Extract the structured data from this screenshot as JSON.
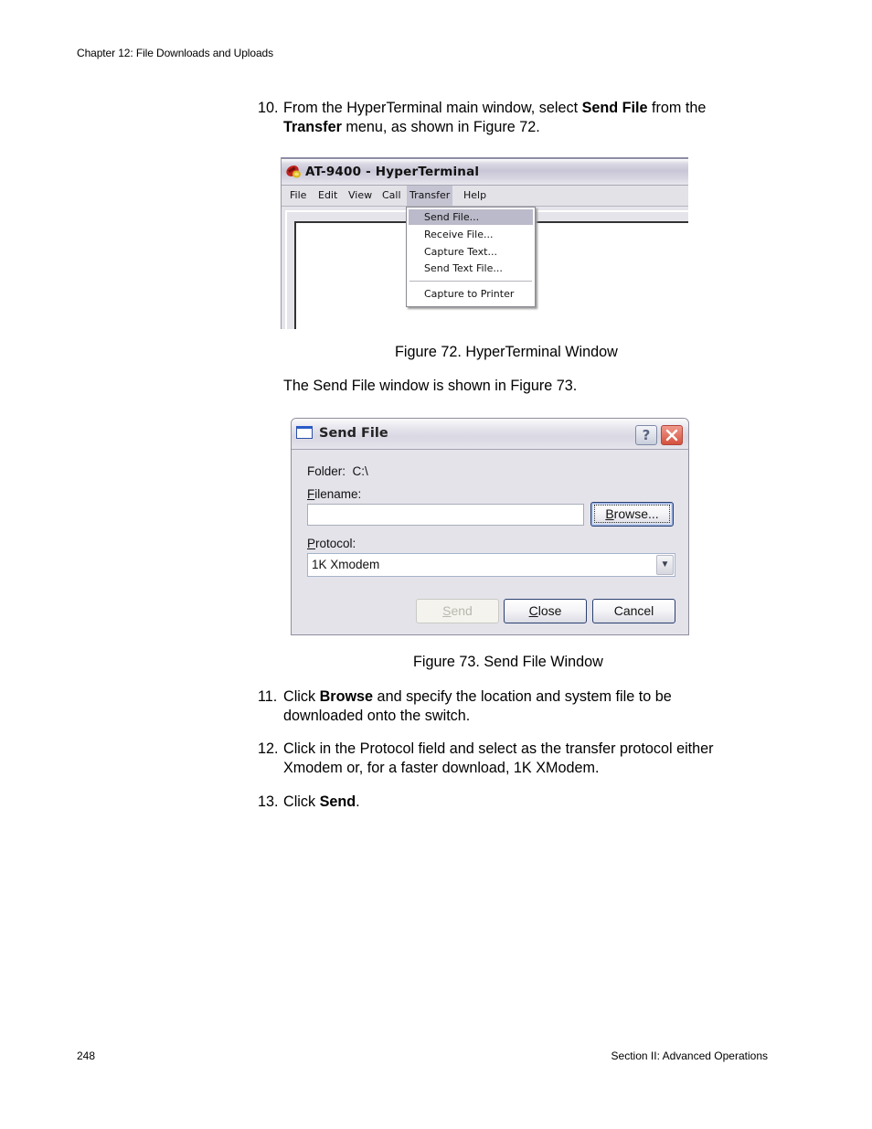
{
  "header": {
    "chapter": "Chapter 12: File Downloads and Uploads"
  },
  "footer": {
    "page_number": "248",
    "section": "Section II: Advanced Operations"
  },
  "steps": {
    "s10": {
      "num": "10.",
      "line1_pre": "From the HyperTerminal main window, select ",
      "line1_bold": "Send File",
      "line1_post": " from the",
      "line2_bold": "Transfer",
      "line2_post": " menu, as shown in Figure 72."
    },
    "s11": {
      "num": "11.",
      "line1_pre": "Click ",
      "line1_bold": "Browse",
      "line1_post": " and specify the location and system file to be",
      "line2": "downloaded onto the switch."
    },
    "s12": {
      "num": "12.",
      "line1": "Click in the Protocol field and select as the transfer protocol either",
      "line2": "Xmodem or, for a faster download, 1K XModem."
    },
    "s13": {
      "num": "13.",
      "pre": "Click ",
      "bold": "Send",
      "post": "."
    }
  },
  "figure72": {
    "caption": "Figure 72. HyperTerminal Window",
    "window_title": "AT-9400 - HyperTerminal",
    "menu": [
      "File",
      "Edit",
      "View",
      "Call",
      "Transfer",
      "Help"
    ],
    "active_menu": "Transfer",
    "transfer_items": [
      "Send File...",
      "Receive File...",
      "Capture Text...",
      "Send Text File...",
      "Capture to Printer"
    ],
    "selected_item": "Send File..."
  },
  "intro73": "The Send File window is shown in Figure 73.",
  "figure73": {
    "caption": "Figure 73. Send File Window",
    "window_title": "Send File",
    "help_glyph": "?",
    "folder_label": "Folder:",
    "folder_value": "C:\\",
    "filename_label_u": "F",
    "filename_label_rest": "ilename:",
    "filename_value": "",
    "browse_u": "B",
    "browse_rest": "rowse...",
    "protocol_label_u": "P",
    "protocol_label_rest": "rotocol:",
    "protocol_value": "1K Xmodem",
    "send_u": "S",
    "send_rest": "end",
    "close_u": "C",
    "close_rest": "lose",
    "cancel": "Cancel"
  },
  "colors": {
    "menu_highlight": "#bbbaca",
    "close_button_red": "#d4503e"
  }
}
